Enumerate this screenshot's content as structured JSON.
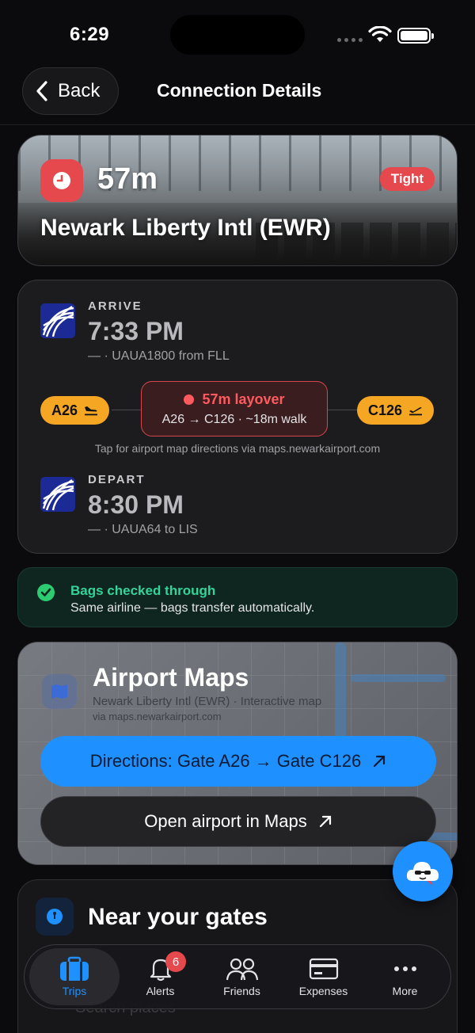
{
  "status_bar": {
    "time": "6:29"
  },
  "header": {
    "back_label": "Back",
    "title": "Connection Details"
  },
  "hero": {
    "duration": "57m",
    "status_badge": "Tight",
    "airport": "Newark Liberty Intl (EWR)",
    "badge_color": "#e5484d"
  },
  "arrive": {
    "label": "ARRIVE",
    "time": "7:33 PM",
    "detail": "— · UAUA1800 from FLL"
  },
  "layover": {
    "from_gate": "A26",
    "to_gate": "C126",
    "title": "57m layover",
    "route": "A26 → C126 · ~18m walk",
    "map_hint": "Tap for airport map directions via maps.newarkairport.com"
  },
  "depart": {
    "label": "DEPART",
    "time": "8:30 PM",
    "detail": "— · UAUA64 to LIS"
  },
  "bags": {
    "title": "Bags checked through",
    "subtitle": "Same airline — bags transfer automatically."
  },
  "airport_maps": {
    "title": "Airport Maps",
    "subtitle": "Newark Liberty Intl (EWR) · Interactive map",
    "source": "via maps.newarkairport.com",
    "directions_label": "Directions: Gate A26 → Gate C126",
    "open_label": "Open airport in Maps"
  },
  "near_gates": {
    "title": "Near your gates",
    "search_placeholder": "Search places"
  },
  "tabs": [
    {
      "label": "Trips",
      "icon": "suitcase-icon",
      "active": true
    },
    {
      "label": "Alerts",
      "icon": "bell-icon",
      "badge": "6"
    },
    {
      "label": "Friends",
      "icon": "people-icon"
    },
    {
      "label": "Expenses",
      "icon": "card-icon"
    },
    {
      "label": "More",
      "icon": "more-icon"
    }
  ],
  "colors": {
    "accent": "#1e90ff",
    "warning": "#f5a623",
    "danger": "#e5484d",
    "success": "#34d399"
  }
}
